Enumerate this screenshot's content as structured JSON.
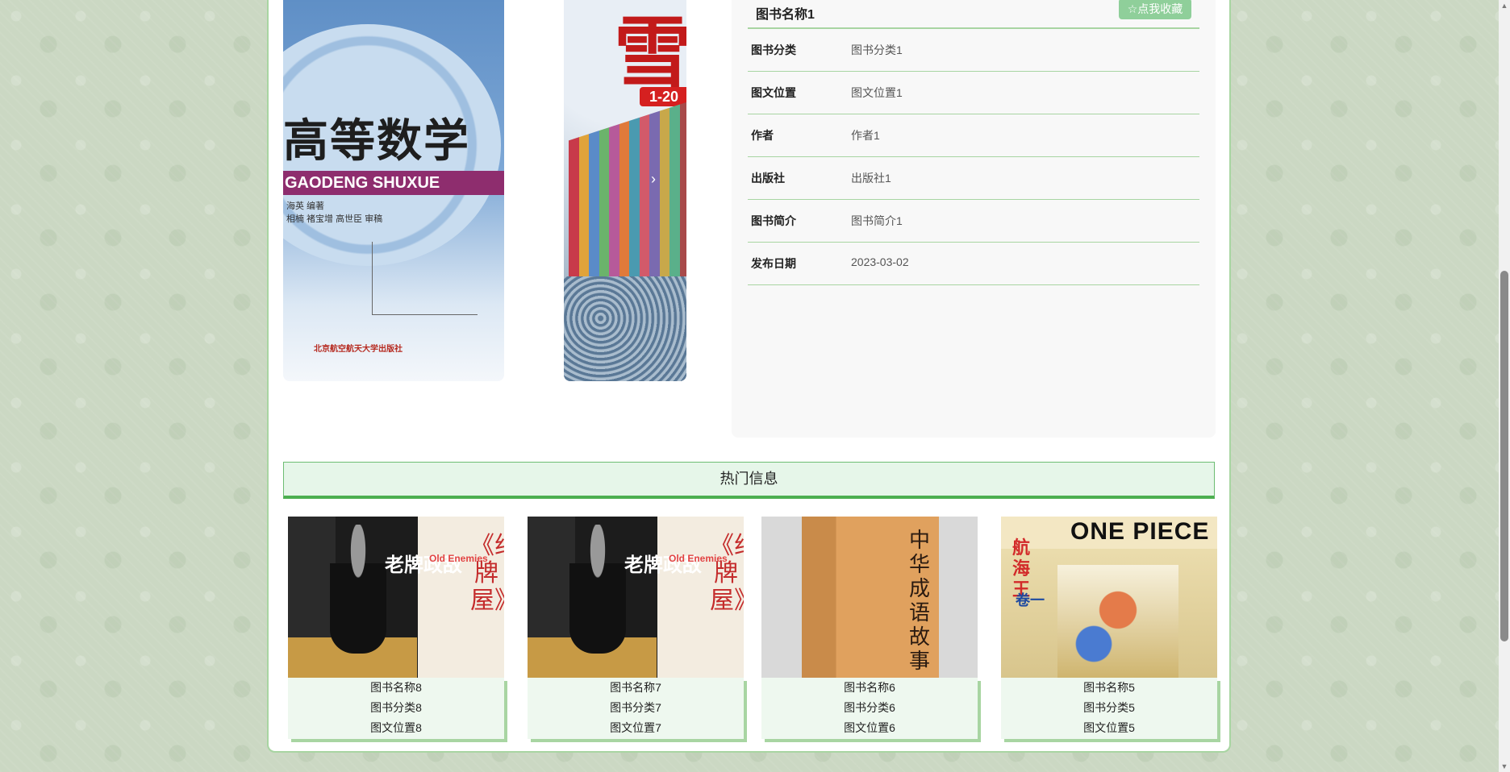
{
  "book": {
    "name": "图书名称1",
    "favorite_label": "☆点我收藏",
    "details": [
      {
        "label": "图书分类",
        "value": "图书分类1"
      },
      {
        "label": "图文位置",
        "value": "图文位置1"
      },
      {
        "label": "作者",
        "value": "作者1"
      },
      {
        "label": "出版社",
        "value": "出版社1"
      },
      {
        "label": "图书简介",
        "value": "图书简介1"
      },
      {
        "label": "发布日期",
        "value": "2023-03-02"
      }
    ]
  },
  "slides": {
    "math": {
      "title": "高等数学",
      "pinyin": "GAODENG SHUXUE",
      "publisher": "北京航空航天大学出版社"
    },
    "snow": {
      "big": "雪",
      "tag": "1-20",
      "arrow": "›"
    }
  },
  "hot": {
    "title": "热门信息",
    "items": [
      {
        "name": "图书名称8",
        "category": "图书分类8",
        "location": "图文位置8",
        "cover": {
          "title": "老牌政敌",
          "en": "Old Enemies",
          "vert": "《纸牌屋》"
        }
      },
      {
        "name": "图书名称7",
        "category": "图书分类7",
        "location": "图文位置7",
        "cover": {
          "title": "老牌政敌",
          "en": "Old Enemies",
          "vert": "《纸牌屋》"
        }
      },
      {
        "name": "图书名称6",
        "category": "图书分类6",
        "location": "图文位置6",
        "cover": {
          "title": "中华成语故事"
        }
      },
      {
        "name": "图书名称5",
        "category": "图书分类5",
        "location": "图文位置5",
        "cover": {
          "logo": "ONE PIECE",
          "hang": "航海王",
          "kun": "卷一"
        }
      }
    ]
  },
  "colors": {
    "accent": "#a8d5a2",
    "primary_green": "#4caf50",
    "button": "#8fcf9a"
  }
}
